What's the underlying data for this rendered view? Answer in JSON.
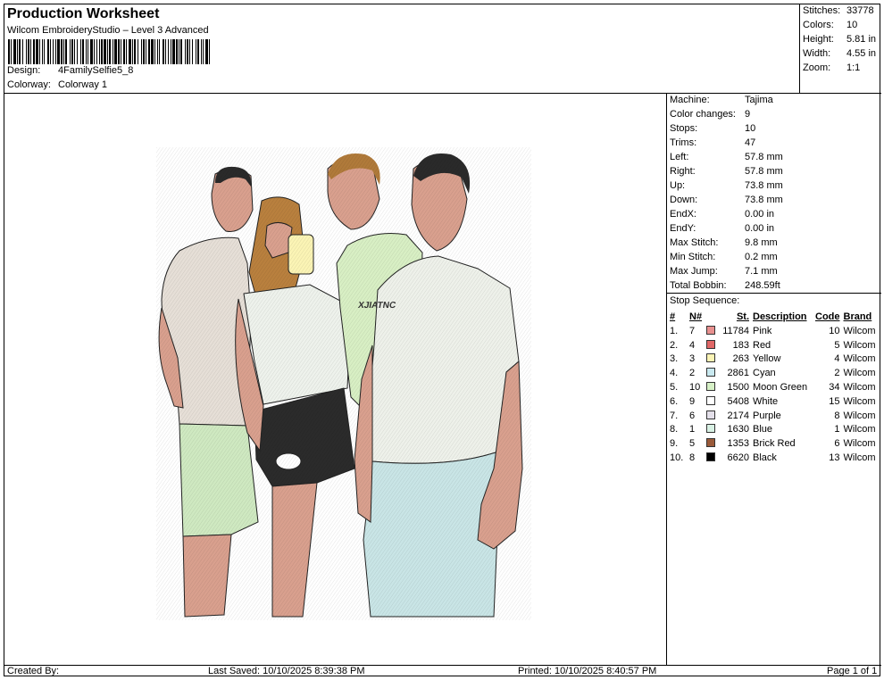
{
  "header": {
    "title": "Production Worksheet",
    "subtitle": "Wilcom EmbroideryStudio – Level 3 Advanced",
    "design_label": "Design:",
    "design_value": "4FamilySelfie5_8",
    "colorway_label": "Colorway:",
    "colorway_value": "Colorway 1"
  },
  "summary": [
    {
      "label": "Stitches:",
      "value": "33778"
    },
    {
      "label": "Colors:",
      "value": "10"
    },
    {
      "label": "Height:",
      "value": "5.81 in"
    },
    {
      "label": "Width:",
      "value": "4.55 in"
    },
    {
      "label": "Zoom:",
      "value": "1:1"
    }
  ],
  "machine_info": [
    {
      "label": "Machine:",
      "value": "Tajima"
    },
    {
      "label": "Color changes:",
      "value": "9"
    },
    {
      "label": "Stops:",
      "value": "10"
    },
    {
      "label": "Trims:",
      "value": "47"
    },
    {
      "label": "Left:",
      "value": "57.8 mm"
    },
    {
      "label": "Right:",
      "value": "57.8 mm"
    },
    {
      "label": "Up:",
      "value": "73.8 mm"
    },
    {
      "label": "Down:",
      "value": "73.8 mm"
    },
    {
      "label": "EndX:",
      "value": "0.00 in"
    },
    {
      "label": "EndY:",
      "value": "0.00 in"
    },
    {
      "label": "Max Stitch:",
      "value": "9.8 mm"
    },
    {
      "label": "Min Stitch:",
      "value": "0.2 mm"
    },
    {
      "label": "Max Jump:",
      "value": "7.1 mm"
    },
    {
      "label": "Total Bobbin:",
      "value": "248.59ft"
    }
  ],
  "stop_sequence": {
    "title": "Stop Sequence:",
    "headers": {
      "idx": "#",
      "n": "N#",
      "st": "St.",
      "desc": "Description",
      "code": "Code",
      "brand": "Brand"
    },
    "rows": [
      {
        "idx": "1.",
        "n": "7",
        "color": "#e8908f",
        "st": "11784",
        "desc": "Pink",
        "code": "10",
        "brand": "Wilcom"
      },
      {
        "idx": "2.",
        "n": "4",
        "color": "#e06767",
        "st": "183",
        "desc": "Red",
        "code": "5",
        "brand": "Wilcom"
      },
      {
        "idx": "3.",
        "n": "3",
        "color": "#fbf4b5",
        "st": "263",
        "desc": "Yellow",
        "code": "4",
        "brand": "Wilcom"
      },
      {
        "idx": "4.",
        "n": "2",
        "color": "#c9e9f0",
        "st": "2861",
        "desc": "Cyan",
        "code": "2",
        "brand": "Wilcom"
      },
      {
        "idx": "5.",
        "n": "10",
        "color": "#d6f0c6",
        "st": "1500",
        "desc": "Moon Green",
        "code": "34",
        "brand": "Wilcom"
      },
      {
        "idx": "6.",
        "n": "9",
        "color": "#ffffff",
        "st": "5408",
        "desc": "White",
        "code": "15",
        "brand": "Wilcom"
      },
      {
        "idx": "7.",
        "n": "6",
        "color": "#e4e0ea",
        "st": "2174",
        "desc": "Purple",
        "code": "8",
        "brand": "Wilcom"
      },
      {
        "idx": "8.",
        "n": "1",
        "color": "#d8f1e4",
        "st": "1630",
        "desc": "Blue",
        "code": "1",
        "brand": "Wilcom"
      },
      {
        "idx": "9.",
        "n": "5",
        "color": "#9a5a3a",
        "st": "1353",
        "desc": "Brick Red",
        "code": "6",
        "brand": "Wilcom"
      },
      {
        "idx": "10.",
        "n": "8",
        "color": "#000000",
        "st": "6620",
        "desc": "Black",
        "code": "13",
        "brand": "Wilcom"
      }
    ]
  },
  "footer": {
    "created_by": "Created By:",
    "last_saved": "Last Saved: 10/10/2025 8:39:38 PM",
    "printed": "Printed: 10/10/2025 8:40:57 PM",
    "page": "Page 1 of 1"
  }
}
